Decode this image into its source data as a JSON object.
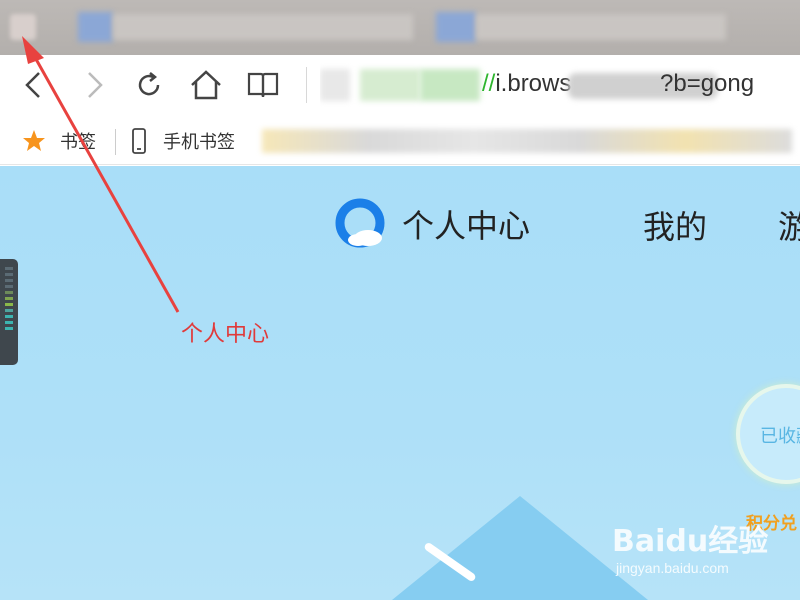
{
  "toolbar": {
    "url_prefix_slash": "//",
    "url_visible": "i.brows",
    "url_tail": "?b=gong"
  },
  "bookmarks": {
    "items": [
      {
        "label": "书签",
        "icon": "star-icon"
      },
      {
        "label": "手机书签",
        "icon": "phone-icon"
      }
    ]
  },
  "page": {
    "title": "个人中心",
    "nav_mine": "我的",
    "nav_game": "游",
    "collect_label": "已收藏",
    "points_label": "积分兑"
  },
  "annotation": {
    "label": "个人中心"
  },
  "watermark": {
    "brand": "Baidu经验",
    "url": "jingyan.baidu.com"
  },
  "colors": {
    "annotation_red": "#e03a3a",
    "content_bg": "#a9def8",
    "url_green": "#2db52d",
    "star_orange": "#f7941d",
    "points_orange": "#f0a020"
  }
}
